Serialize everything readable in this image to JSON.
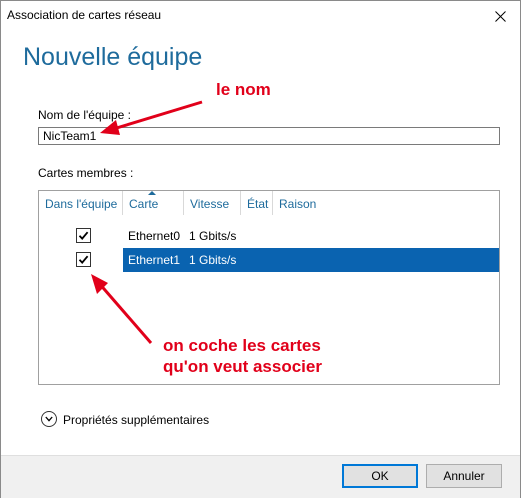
{
  "window": {
    "title": "Association de cartes réseau"
  },
  "heading": "Nouvelle équipe",
  "team_name": {
    "label": "Nom de l'équipe :",
    "value": "NicTeam1"
  },
  "members": {
    "label": "Cartes membres :",
    "columns": [
      "Dans l'équipe",
      "Carte",
      "Vitesse",
      "État",
      "Raison"
    ],
    "rows": [
      {
        "checked": true,
        "card": "Ethernet0",
        "speed": "1 Gbits/s",
        "state": "",
        "reason": "",
        "selected": false
      },
      {
        "checked": true,
        "card": "Ethernet1",
        "speed": "1 Gbits/s",
        "state": "",
        "reason": "",
        "selected": true
      }
    ]
  },
  "more_props": {
    "label": "Propriétés supplémentaires"
  },
  "buttons": {
    "ok": "OK",
    "cancel": "Annuler"
  },
  "annotations": {
    "name_note": "le nom",
    "check_note_line1": "on coche les cartes",
    "check_note_line2": "qu'on veut associer"
  },
  "colors": {
    "accent": "#1e6b9c",
    "selection": "#0a63b0",
    "annotation": "#e1001a"
  }
}
